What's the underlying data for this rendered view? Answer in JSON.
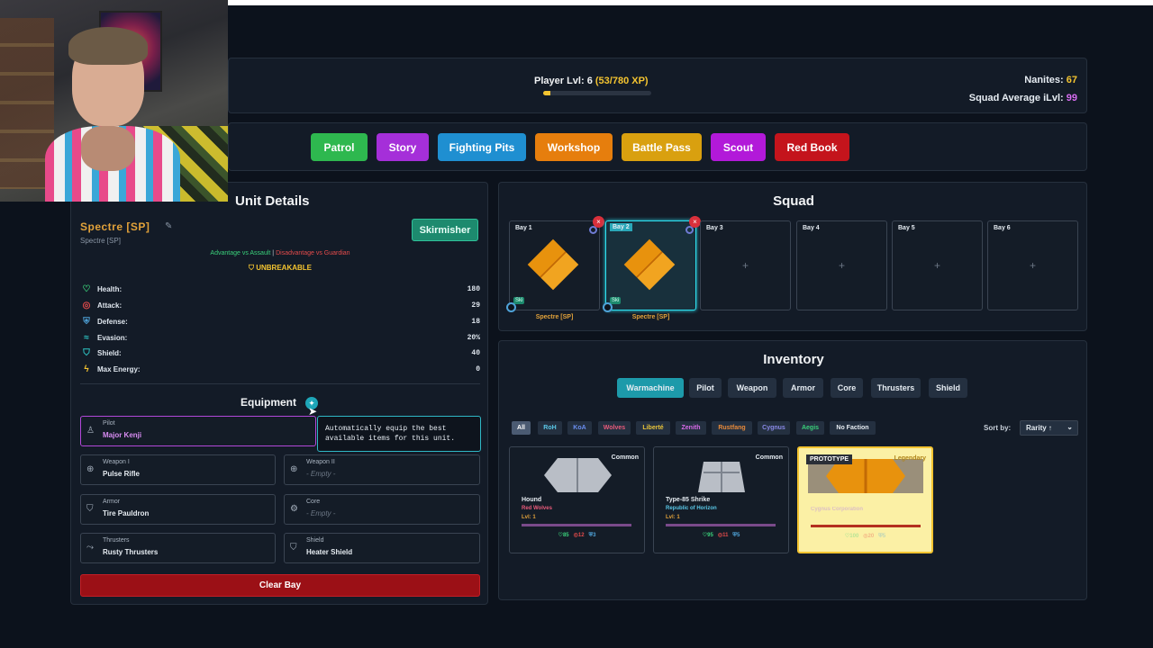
{
  "header": {
    "player_lvl_label": "Player Lvl: 6",
    "player_xp": "(53/780 XP)",
    "xp_progress": 0.068,
    "nanites_label": "Nanites:",
    "nanites_value": "67",
    "squad_ilvl_label": "Squad Average iLvl:",
    "squad_ilvl_value": "99"
  },
  "nav": [
    {
      "label": "Patrol",
      "color": "#2eb84f"
    },
    {
      "label": "Story",
      "color": "#a52fd9"
    },
    {
      "label": "Fighting Pits",
      "color": "#1f8fd1"
    },
    {
      "label": "Workshop",
      "color": "#e67e0d"
    },
    {
      "label": "Battle Pass",
      "color": "#d9a00f"
    },
    {
      "label": "Scout",
      "color": "#b219d9"
    },
    {
      "label": "Red Book",
      "color": "#c4141c"
    }
  ],
  "unit": {
    "title": "Unit Details",
    "name": "Spectre [SP]",
    "subname": "Spectre [SP]",
    "role": "Skirmisher",
    "advantage": "Advantage vs Assault",
    "separator": "|",
    "disadvantage": "Disadvantage vs Guardian",
    "trait": "UNBREAKABLE",
    "stats": [
      {
        "label": "Health:",
        "value": "180",
        "icon": "heart-icon",
        "color": "#3ad07a"
      },
      {
        "label": "Attack:",
        "value": "29",
        "icon": "target-icon",
        "color": "#e44b4b"
      },
      {
        "label": "Defense:",
        "value": "18",
        "icon": "shield-icon",
        "color": "#4fa3d9"
      },
      {
        "label": "Evasion:",
        "value": "20%",
        "icon": "wind-icon",
        "color": "#2ec6c6"
      },
      {
        "label": "Shield:",
        "value": "40",
        "icon": "shield-outline-icon",
        "color": "#2ec6c6"
      },
      {
        "label": "Max Energy:",
        "value": "0",
        "icon": "bolt-icon",
        "color": "#f4c430"
      }
    ],
    "equipment_title": "Equipment",
    "tooltip": "Automatically equip the best available items for this unit.",
    "slots": {
      "pilot": {
        "label": "Pilot",
        "value": "Major Kenji"
      },
      "weapon1": {
        "label": "Weapon I",
        "value": "Pulse Rifle"
      },
      "weapon2": {
        "label": "Weapon II",
        "value": "- Empty -"
      },
      "armor": {
        "label": "Armor",
        "value": "Tire Pauldron"
      },
      "core": {
        "label": "Core",
        "value": "- Empty -"
      },
      "thrusters": {
        "label": "Thrusters",
        "value": "Rusty Thrusters"
      },
      "shield": {
        "label": "Shield",
        "value": "Heater Shield"
      }
    },
    "clear_bay": "Clear Bay"
  },
  "squad": {
    "title": "Squad",
    "bays": [
      {
        "label": "Bay 1",
        "unit": "Spectre [SP]",
        "tag": "Ski"
      },
      {
        "label": "Bay 2",
        "unit": "Spectre [SP]",
        "tag": "Ski"
      },
      {
        "label": "Bay 3",
        "plus": "+"
      },
      {
        "label": "Bay 4",
        "plus": "+"
      },
      {
        "label": "Bay 5",
        "plus": "+"
      },
      {
        "label": "Bay 6",
        "plus": "+"
      }
    ],
    "remove": "×"
  },
  "inventory": {
    "title": "Inventory",
    "tabs": [
      "Warmachine",
      "Pilot",
      "Weapon",
      "Armor",
      "Core",
      "Thrusters",
      "Shield"
    ],
    "filters": [
      {
        "label": "All",
        "color": "#ffffff"
      },
      {
        "label": "RoH",
        "color": "#5ac8e8"
      },
      {
        "label": "KoA",
        "color": "#6a8ef0"
      },
      {
        "label": "Wolves",
        "color": "#e85a7a"
      },
      {
        "label": "Liberté",
        "color": "#e8c33a"
      },
      {
        "label": "Zenith",
        "color": "#d86ae8"
      },
      {
        "label": "Rustfang",
        "color": "#e88a3a"
      },
      {
        "label": "Cygnus",
        "color": "#8a8ae8"
      },
      {
        "label": "Aegis",
        "color": "#3ad07a"
      },
      {
        "label": "No Faction",
        "color": "#e6ecf2"
      }
    ],
    "sort_label": "Sort by:",
    "sort_value": "Rarity ↑",
    "cards": [
      {
        "rarity": "Common",
        "name": "Hound",
        "faction": "Red Wolves",
        "faction_color": "#e85a7a",
        "level": "Lvl: 1",
        "health": "85",
        "attack": "12",
        "defense": "3"
      },
      {
        "rarity": "Common",
        "name": "Type-85 Shrike",
        "faction": "Republic of Horizon",
        "faction_color": "#5ac8e8",
        "level": "Lvl: 1",
        "health": "95",
        "attack": "11",
        "defense": "5"
      },
      {
        "rarity": "Legendary",
        "badge": "PROTOTYPE",
        "name": "",
        "faction": "Cygnus Corporation",
        "faction_color": "#c9a0d8",
        "level": "",
        "health": "100",
        "attack": "20",
        "defense": "5"
      }
    ]
  }
}
